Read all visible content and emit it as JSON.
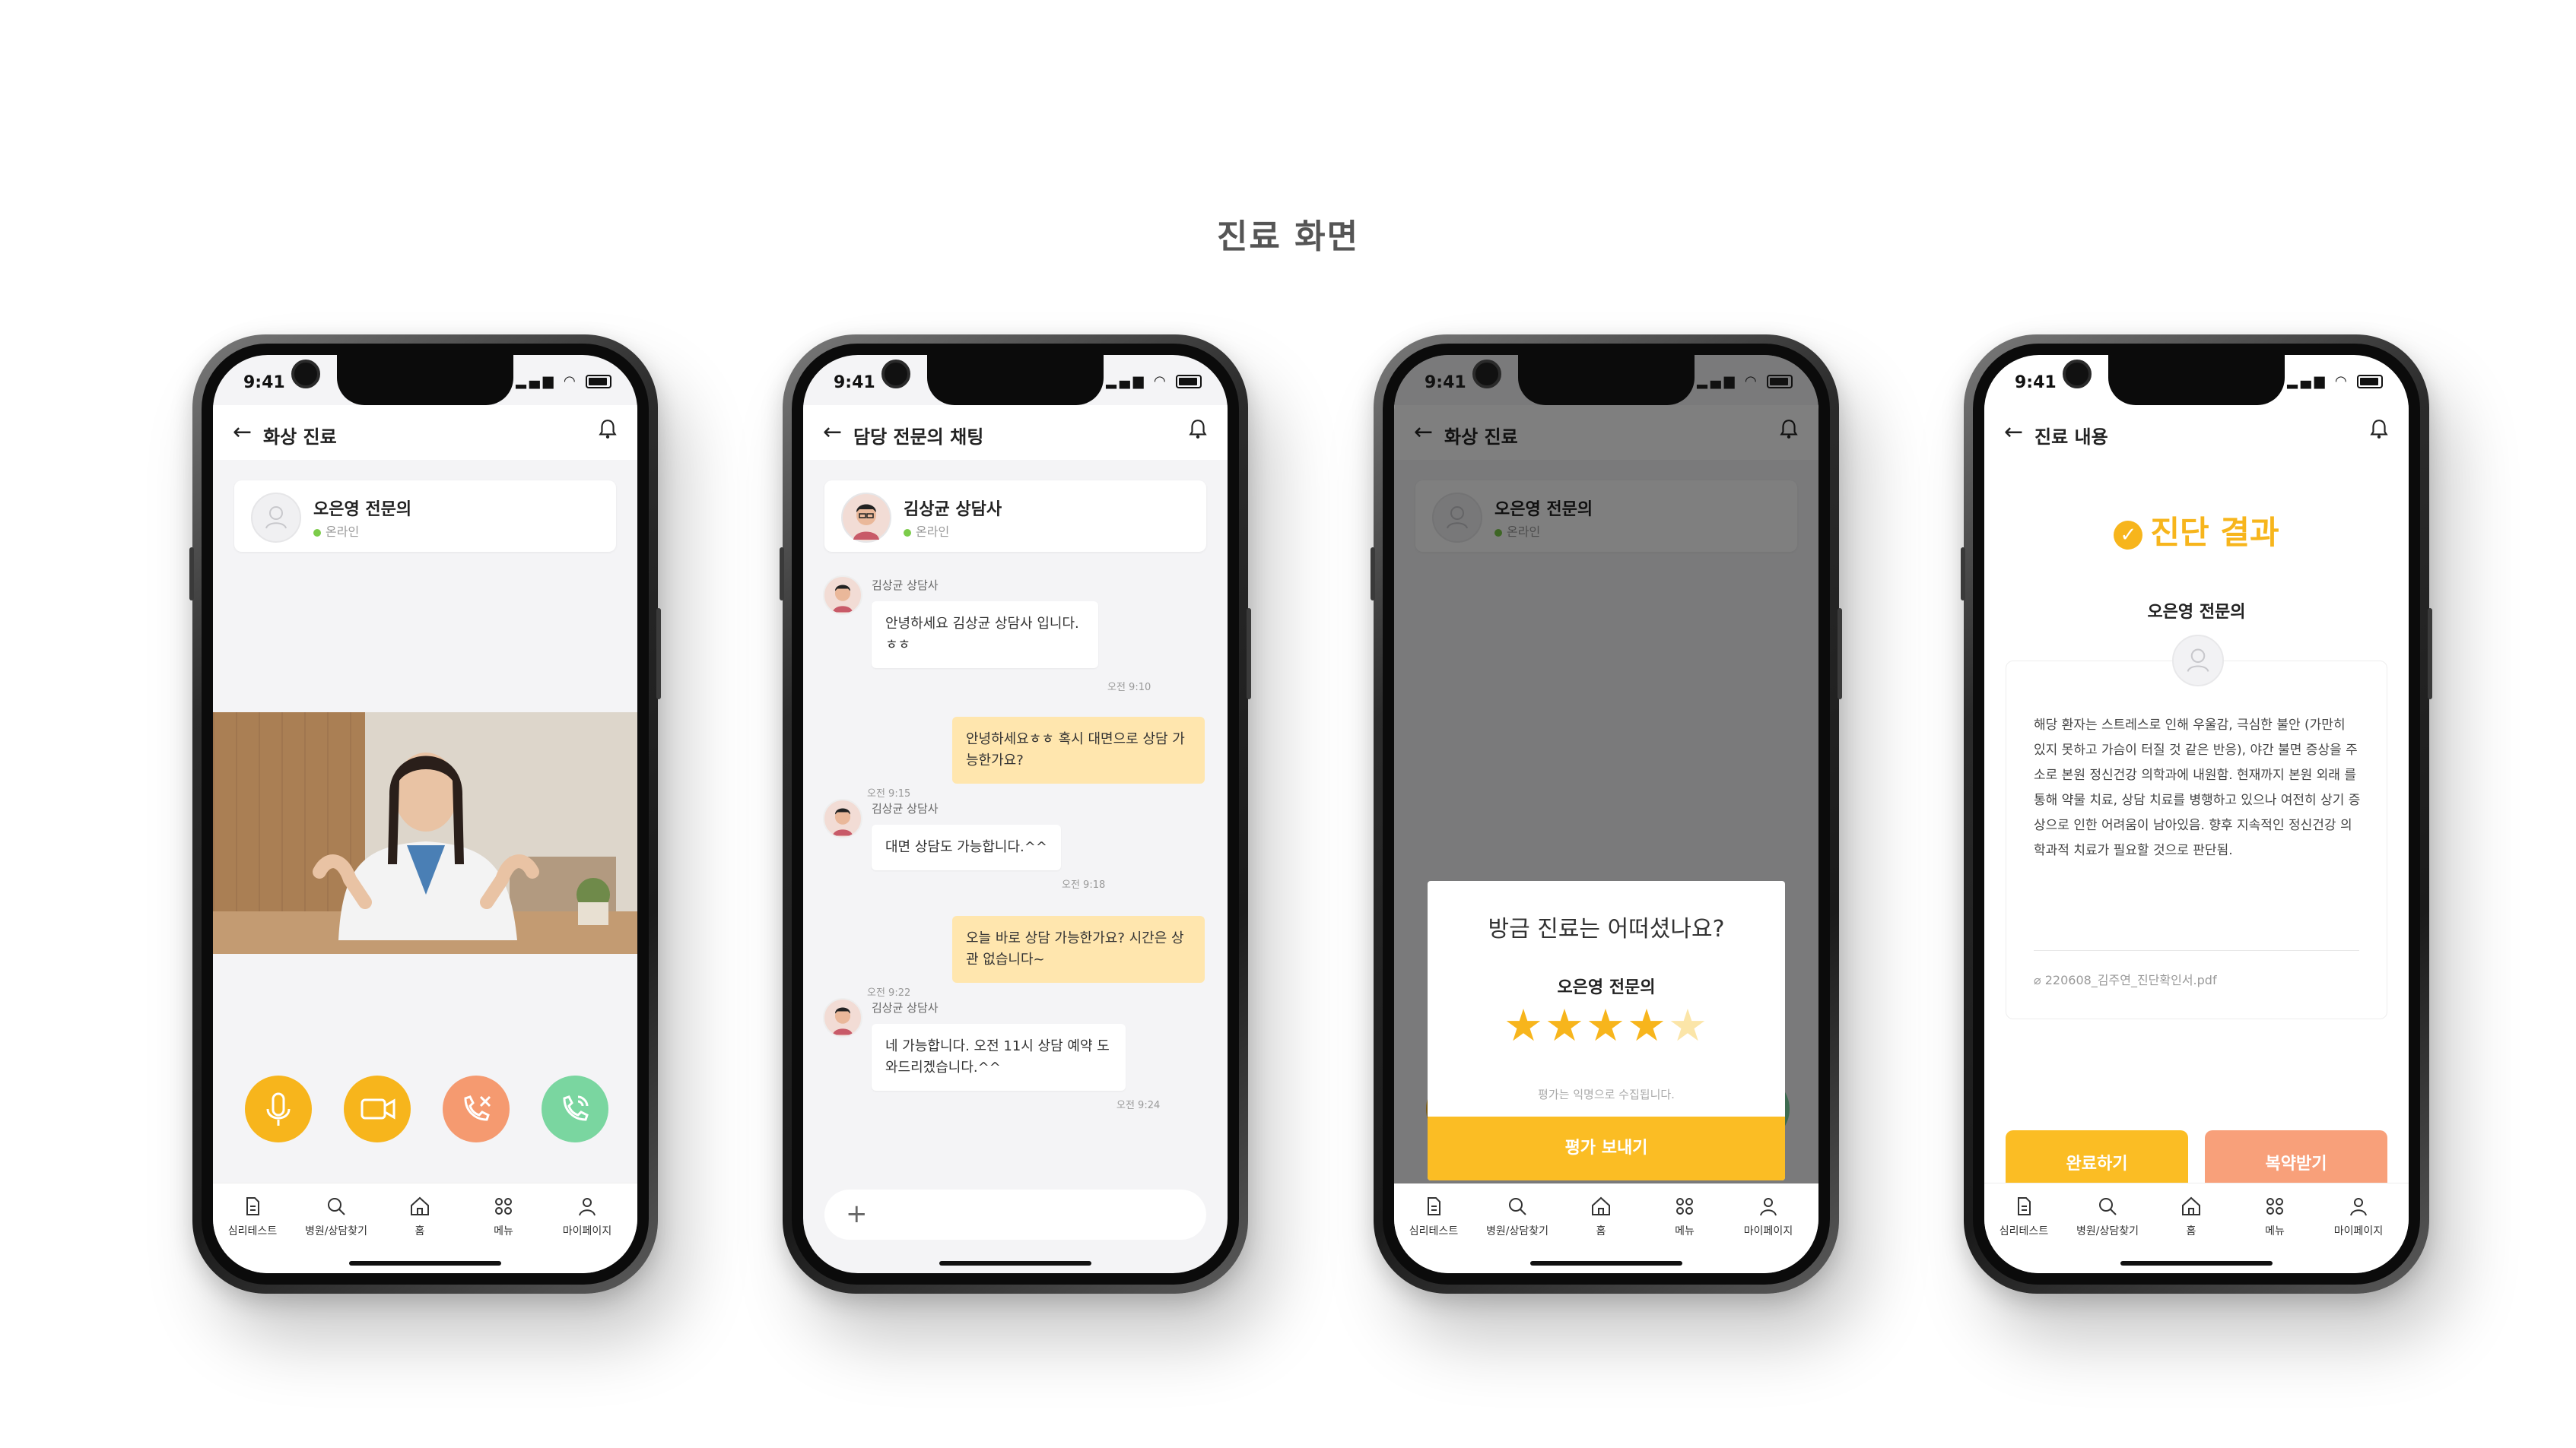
{
  "page": {
    "title": "진료 화면"
  },
  "status": {
    "time": "9:41"
  },
  "tabbar": {
    "items": [
      {
        "label": "심리테스트",
        "icon": "document-icon"
      },
      {
        "label": "병원/상담찾기",
        "icon": "search-icon"
      },
      {
        "label": "홈",
        "icon": "home-icon"
      },
      {
        "label": "메뉴",
        "icon": "grid-icon"
      },
      {
        "label": "마이페이지",
        "icon": "user-icon"
      }
    ]
  },
  "video_call": {
    "header_title": "화상 진료",
    "doctor_name": "오은영 전문의",
    "status": "온라인",
    "buttons": [
      {
        "name": "mic",
        "icon": "microphone-icon",
        "color": "#f7b51c"
      },
      {
        "name": "camera",
        "icon": "video-camera-icon",
        "color": "#f7b51c"
      },
      {
        "name": "hangup",
        "icon": "phone-off-icon",
        "color": "#f59a70"
      },
      {
        "name": "call",
        "icon": "phone-call-icon",
        "color": "#7ad6a0"
      }
    ]
  },
  "chat": {
    "header_title": "담당 전문의 채팅",
    "counselor_name": "김상균 상담사",
    "status": "온라인",
    "messages": [
      {
        "from": "in",
        "sender": "김상균 상담사",
        "text": "안녕하세요 김상균 상담사 입니다. ㅎㅎ",
        "time": "오전 9:10"
      },
      {
        "from": "out",
        "text": "안녕하세요ㅎㅎ 혹시 대면으로 상담 가능한가요?",
        "time": "오전 9:15"
      },
      {
        "from": "in",
        "sender": "김상균 상담사",
        "text": "대면 상담도 가능합니다.^^",
        "time": "오전 9:18"
      },
      {
        "from": "out",
        "text": "오늘 바로 상담 가능한가요? 시간은 상관 없습니다~",
        "time": "오전 9:22"
      },
      {
        "from": "in",
        "sender": "김상균 상담사",
        "text": "네 가능합니다. 오전 11시 상담 예약 도와드리겠습니다.^^",
        "time": "오전 9:24"
      }
    ],
    "input_plus": "+"
  },
  "rating": {
    "header_title": "화상 진료",
    "doctor_name": "오은영 전문의",
    "status": "온라인",
    "question": "방금 진료는 어떠셨나요?",
    "doctor": "오은영 전문의",
    "stars_filled": 4,
    "stars_total": 5,
    "note": "평가는 익명으로 수집됩니다.",
    "submit_label": "평가 보내기"
  },
  "result": {
    "header_title": "진료 내용",
    "title": "진단 결과",
    "doctor": "오은영 전문의",
    "body": "해당 환자는 스트레스로 인해 우울감, 극심한 불안 (가만히 있지 못하고 가슴이 터질 것 같은 반응), 야간 불면 증상을 주소로 본원 정신건강 의학과에 내원함. 현재까지 본원 외래 를 통해 약물 치료, 상담 치료를 병행하고 있으나 여전히 상기 증상으로 인한 어려움이 남아있음. 향후 지속적인 정신건강 의학과적 치료가 필요할 것으로 판단됨.",
    "file": "220608_김주연_진단확인서.pdf",
    "complete_label": "완료하기",
    "reserve_label": "복약받기",
    "colors": {
      "accent": "#fbbd24",
      "secondary": "#f8a07a"
    }
  }
}
